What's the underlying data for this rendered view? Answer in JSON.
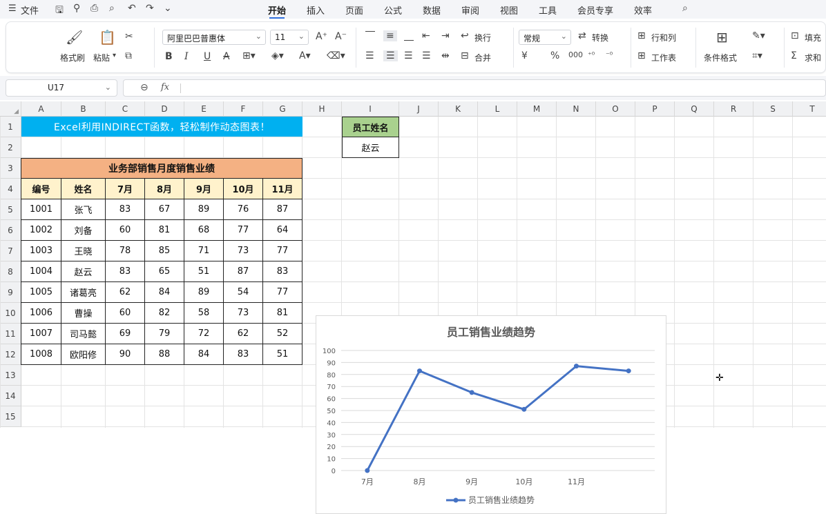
{
  "menubar": {
    "file": "文件",
    "tabs": [
      "开始",
      "插入",
      "页面",
      "公式",
      "数据",
      "审阅",
      "视图",
      "工具",
      "会员专享",
      "效率"
    ],
    "active_tab": "开始"
  },
  "ribbon": {
    "format_painter": "格式刷",
    "paste": "粘贴",
    "font_name": "阿里巴巴普惠体",
    "font_size": "11",
    "wrap": "换行",
    "merge": "合并",
    "number_format": "常规",
    "convert": "转换",
    "rows_cols": "行和列",
    "worksheet": "工作表",
    "cond_format": "条件格式",
    "fill": "填充",
    "sum": "求和",
    "bold": "B",
    "italic": "I",
    "underline": "U",
    "strike": "A",
    "currency": "¥",
    "percent": "%",
    "fx": "fx"
  },
  "formula_bar": {
    "name_box": "U17",
    "formula": ""
  },
  "columns": [
    "A",
    "B",
    "C",
    "D",
    "E",
    "F",
    "G",
    "H",
    "I",
    "J",
    "K",
    "L",
    "M",
    "N",
    "O",
    "P",
    "Q",
    "R",
    "S",
    "T"
  ],
  "rows": [
    "1",
    "2",
    "3",
    "4",
    "5",
    "6",
    "7",
    "8",
    "9",
    "10",
    "11",
    "12",
    "13",
    "14",
    "15"
  ],
  "sheet": {
    "banner": "Excel利用INDIRECT函数，轻松制作动态图表！",
    "table_title": "业务部销售月度销售业绩",
    "headers": [
      "编号",
      "姓名",
      "7月",
      "8月",
      "9月",
      "10月",
      "11月"
    ],
    "data": [
      [
        "1001",
        "张飞",
        "83",
        "67",
        "89",
        "76",
        "87"
      ],
      [
        "1002",
        "刘备",
        "60",
        "81",
        "68",
        "77",
        "64"
      ],
      [
        "1003",
        "王晓",
        "78",
        "85",
        "71",
        "73",
        "77"
      ],
      [
        "1004",
        "赵云",
        "83",
        "65",
        "51",
        "87",
        "83"
      ],
      [
        "1005",
        "诸葛亮",
        "62",
        "84",
        "89",
        "54",
        "77"
      ],
      [
        "1006",
        "曹操",
        "60",
        "82",
        "58",
        "73",
        "81"
      ],
      [
        "1007",
        "司马懿",
        "69",
        "79",
        "72",
        "62",
        "52"
      ],
      [
        "1008",
        "欧阳修",
        "90",
        "88",
        "84",
        "83",
        "51"
      ]
    ],
    "lookup_label": "员工姓名",
    "lookup_value": "赵云"
  },
  "colors": {
    "banner_bg": "#00b0f0",
    "title_bg": "#f4b183",
    "header_bg": "#fff2cc",
    "lookup_bg": "#a9d18e",
    "line": "#4472c4"
  },
  "chart_data": {
    "type": "line",
    "title": "员工销售业绩趋势",
    "categories": [
      "7月",
      "8月",
      "9月",
      "10月",
      "11月"
    ],
    "series": [
      {
        "name": "员工销售业绩趋势",
        "values": [
          0,
          83,
          65,
          51,
          87,
          83
        ]
      }
    ],
    "x_points": 6,
    "ylim": [
      0,
      100
    ],
    "yticks": [
      0,
      10,
      20,
      30,
      40,
      50,
      60,
      70,
      80,
      90,
      100
    ],
    "grid": true,
    "legend": "bottom"
  }
}
